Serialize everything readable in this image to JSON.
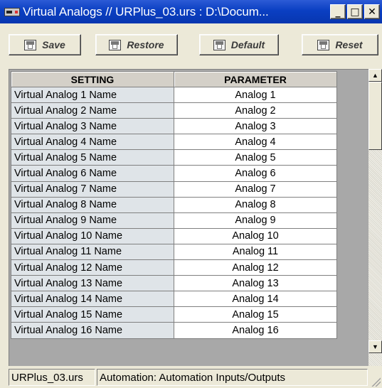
{
  "window": {
    "title": "Virtual Analogs // URPlus_03.urs : D:\\Docum...",
    "minimize_glyph": "_",
    "maximize_glyph": "□",
    "close_glyph": "✕"
  },
  "toolbar": {
    "save_label": "Save",
    "restore_label": "Restore",
    "default_label": "Default",
    "reset_label": "Reset"
  },
  "table": {
    "columns": [
      "SETTING",
      "PARAMETER"
    ],
    "rows": [
      {
        "setting": "Virtual Analog 1 Name",
        "parameter": "Analog 1"
      },
      {
        "setting": "Virtual Analog 2 Name",
        "parameter": "Analog 2"
      },
      {
        "setting": "Virtual Analog 3 Name",
        "parameter": "Analog 3"
      },
      {
        "setting": "Virtual Analog 4 Name",
        "parameter": "Analog 4"
      },
      {
        "setting": "Virtual Analog 5 Name",
        "parameter": "Analog 5"
      },
      {
        "setting": "Virtual Analog 6 Name",
        "parameter": "Analog 6"
      },
      {
        "setting": "Virtual Analog 7 Name",
        "parameter": "Analog 7"
      },
      {
        "setting": "Virtual Analog 8 Name",
        "parameter": "Analog 8"
      },
      {
        "setting": "Virtual Analog 9 Name",
        "parameter": "Analog 9"
      },
      {
        "setting": "Virtual Analog 10 Name",
        "parameter": "Analog 10"
      },
      {
        "setting": "Virtual Analog 11 Name",
        "parameter": "Analog 11"
      },
      {
        "setting": "Virtual Analog 12 Name",
        "parameter": "Analog 12"
      },
      {
        "setting": "Virtual Analog 13 Name",
        "parameter": "Analog 13"
      },
      {
        "setting": "Virtual Analog 14 Name",
        "parameter": "Analog 14"
      },
      {
        "setting": "Virtual Analog 15 Name",
        "parameter": "Analog 15"
      },
      {
        "setting": "Virtual Analog 16 Name",
        "parameter": "Analog 16"
      }
    ]
  },
  "scrollbar": {
    "up_glyph": "▲",
    "down_glyph": "▼"
  },
  "status": {
    "file": "URPlus_03.urs",
    "path": "Automation: Automation Inputs/Outputs"
  },
  "colors": {
    "titlebar": "#0a3fc2",
    "setting_cell_bg": "#dfe4e8",
    "parameter_cell_bg": "#ffffff",
    "grid_bg": "#a8a8a8"
  },
  "icons": [
    "app-icon",
    "save-icon",
    "restore-icon",
    "default-icon",
    "reset-icon"
  ]
}
